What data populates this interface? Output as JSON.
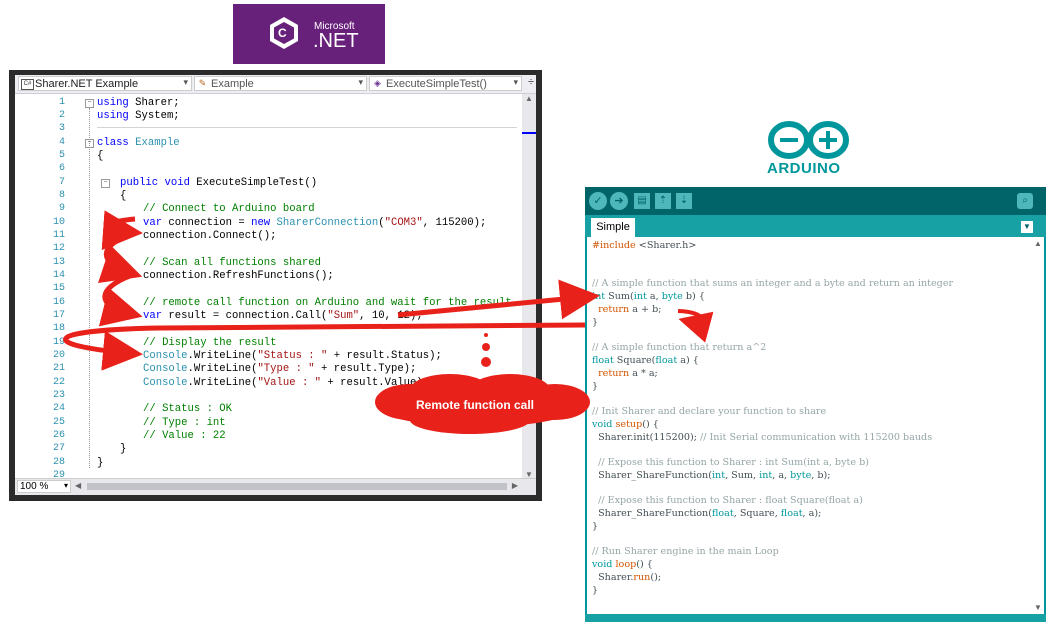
{
  "dotnet_badge": {
    "vendor": "Microsoft",
    "product": ".NET"
  },
  "vs": {
    "nav": {
      "project": "Sharer.NET Example",
      "class": "Example",
      "method": "ExecuteSimpleTest()"
    },
    "zoom": "100 %",
    "line_numbers": [
      "1",
      "2",
      "3",
      "4",
      "5",
      "6",
      "7",
      "8",
      "9",
      "10",
      "11",
      "12",
      "13",
      "14",
      "15",
      "16",
      "17",
      "18",
      "19",
      "20",
      "21",
      "22",
      "23",
      "24",
      "25",
      "26",
      "27",
      "28",
      "29"
    ],
    "code": {
      "l1_kw": "using",
      "l1_rest": " Sharer;",
      "l2_kw": "using",
      "l2_rest": " System;",
      "l4_kw": "class",
      "l4_ty": " Example",
      "l5": "{",
      "l7_kw": "public void",
      "l7_rest": " ExecuteSimpleTest()",
      "l8": "{",
      "l9": "// Connect to Arduino board",
      "l10_a": "var",
      "l10_b": " connection = ",
      "l10_c": "new",
      "l10_d": " SharerConnection",
      "l10_e": "(",
      "l10_f": "\"COM3\"",
      "l10_g": ", 115200);",
      "l11": "connection.Connect();",
      "l13": "// Scan all functions shared",
      "l14": "connection.RefreshFunctions();",
      "l16": "// remote call function on Arduino and wait for the result",
      "l17_a": "var",
      "l17_b": " result = connection.Call(",
      "l17_c": "\"Sum\"",
      "l17_d": ", 10, 12);",
      "l19": "// Display the result",
      "l20_a": "Console",
      "l20_b": ".WriteLine(",
      "l20_c": "\"Status : \"",
      "l20_d": " + result.Status);",
      "l21_a": "Console",
      "l21_b": ".WriteLine(",
      "l21_c": "\"Type : \"",
      "l21_d": " + result.Type);",
      "l22_a": "Console",
      "l22_b": ".WriteLine(",
      "l22_c": "\"Value : \"",
      "l22_d": " + result.Value);",
      "l24": "// Status : OK",
      "l25": "// Type : int",
      "l26": "// Value : 22",
      "l27": "}",
      "l28": "}"
    }
  },
  "arduino_logo": {
    "word": "ARDUINO"
  },
  "arduino": {
    "tab": "Simple",
    "lines": {
      "a1a": "#include",
      "a1b": " <Sharer.h>",
      "a3": "// A simple function that sums an integer and a byte and return an integer",
      "a4a": "int",
      "a4b": " Sum(",
      "a4c": "int",
      "a4d": " a, ",
      "a4e": "byte",
      "a4f": " b) {",
      "a5a": "  return",
      "a5b": " a + b;",
      "a6": "}",
      "a8": "// A simple function that return a^2",
      "a9a": "float",
      "a9b": " Square(",
      "a9c": "float",
      "a9d": " a) {",
      "a10a": "  return",
      "a10b": " a * a;",
      "a11": "}",
      "a13": "// Init Sharer and declare your function to share",
      "a14a": "void",
      "a14b": " ",
      "a14c": "setup",
      "a14d": "() {",
      "a15a": "  Sharer.init(115200); ",
      "a15b": "// Init Serial communication with 115200 bauds",
      "a17": "  // Expose this function to Sharer : int Sum(int a, byte b)",
      "a18a": "  Sharer_ShareFunction(",
      "a18b": "int",
      "a18c": ", Sum, ",
      "a18d": "int",
      "a18e": ", a, ",
      "a18f": "byte",
      "a18g": ", b);",
      "a20": "  // Expose this function to Sharer : float Square(float a)",
      "a21a": "  Sharer_ShareFunction(",
      "a21b": "float",
      "a21c": ", Square, ",
      "a21d": "float",
      "a21e": ", a);",
      "a22": "}",
      "a24": "// Run Sharer engine in the main Loop",
      "a25a": "void",
      "a25b": " ",
      "a25c": "loop",
      "a25d": "() {",
      "a26a": "  Sharer.",
      "a26b": "run",
      "a26c": "();",
      "a27": "}"
    }
  },
  "callout": "Remote function call",
  "colors": {
    "dotnet_purple": "#68217a",
    "arduino_teal": "#00979c",
    "arrow_red": "#e8221b"
  }
}
